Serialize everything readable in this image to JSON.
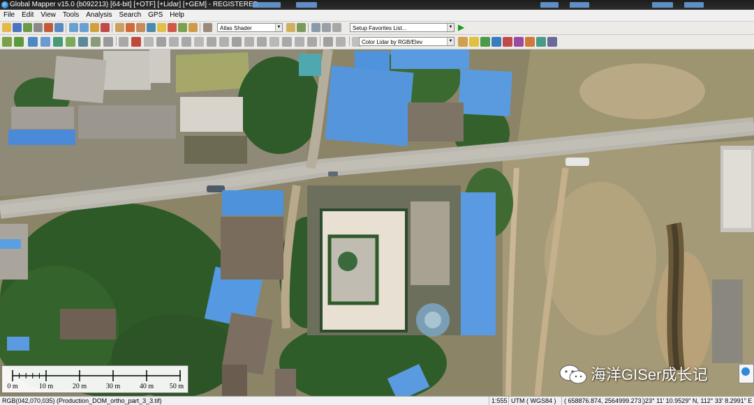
{
  "window": {
    "title": "Global Mapper v15.0 (b092213) [64-bit] [+OTF] [+Lidar] [+GEM] - REGISTERED"
  },
  "menu": {
    "items": [
      "File",
      "Edit",
      "View",
      "Tools",
      "Analysis",
      "Search",
      "GPS",
      "Help"
    ]
  },
  "toolbar": {
    "shader_select": "Atlas Shader",
    "favorites_select": "Setup Favorites List...",
    "lidar_color_select": "Color Lidar by RGB/Elev"
  },
  "scalebar": {
    "labels": [
      "0 m",
      "10 m",
      "20 m",
      "30 m",
      "40 m",
      "50 m"
    ]
  },
  "watermark": {
    "text": "海洋GISer成长记"
  },
  "status": {
    "pixel_info": "RGB(042,070,035) (Production_DOM_ortho_part_3_3.tif)",
    "scale": "1:555",
    "projection": "UTM ( WGS84 )",
    "projected_coords": "( 658876.874, 2564999.273 )",
    "geo_coords": "23° 11' 10.9529\" N, 112° 33' 8.2991\" E"
  },
  "colors": {
    "roof_blue": "#5a9ee0",
    "vegetation": "#2f5a2a",
    "road": "#b8b5ae",
    "bare_soil": "#b7a480",
    "accent": "#1f6fcf"
  },
  "icons": {
    "toolbar": [
      "open-icon",
      "save-icon",
      "print-icon",
      "zoom-in-icon",
      "zoom-out-icon",
      "pan-icon",
      "digitizer-icon",
      "measure-icon",
      "info-icon",
      "3d-view-icon",
      "lidar-icon",
      "run-icon"
    ]
  }
}
